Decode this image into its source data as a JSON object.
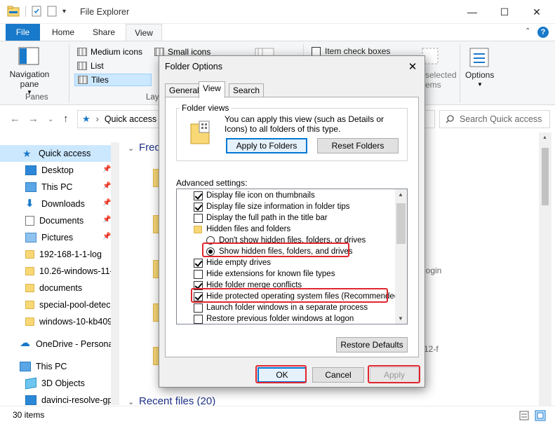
{
  "window": {
    "title": "File Explorer",
    "minimize": "—",
    "maximize": "☐",
    "close": "✕"
  },
  "ribbon_tabs": [
    "File",
    "Home",
    "Share",
    "View"
  ],
  "ribbon": {
    "navigation_pane": "Navigation\npane",
    "panes_label": "Panes",
    "layout_label": "Lay",
    "layout_items": [
      "Medium icons",
      "Small icons",
      "List",
      "Tiles"
    ],
    "item_check_boxes": "Item check boxes",
    "hide_selected": "selected\nems",
    "options": "Options"
  },
  "address": {
    "location": "Quick access",
    "search_placeholder": "Search Quick access"
  },
  "nav_items": [
    "Quick access",
    "Desktop",
    "This PC",
    "Downloads",
    "Documents",
    "Pictures",
    "192-168-1-1-log",
    "10.26-windows-11-",
    "documents",
    "special-pool-detec",
    "windows-10-kb409",
    "OneDrive - Personal",
    "This PC",
    "3D Objects",
    "davinci-resolve-gp"
  ],
  "content": {
    "frequent_header": "Freq",
    "recent_header": "Recent files (20)",
    "bg_texts": [
      "login",
      "12-f"
    ]
  },
  "status": {
    "count": "30 items"
  },
  "dialog": {
    "title": "Folder Options",
    "tabs": [
      "General",
      "View",
      "Search"
    ],
    "folder_views_title": "Folder views",
    "folder_views_text": "You can apply this view (such as Details or Icons) to all folders of this type.",
    "apply_to_folders": "Apply to Folders",
    "reset_folders": "Reset Folders",
    "advanced_label": "Advanced settings:",
    "advanced_items": [
      {
        "text": "Display file icon on thumbnails",
        "type": "checkbox",
        "checked": true
      },
      {
        "text": "Display file size information in folder tips",
        "type": "checkbox",
        "checked": true
      },
      {
        "text": "Display the full path in the title bar",
        "type": "checkbox",
        "checked": false
      },
      {
        "text": "Hidden files and folders",
        "type": "folder",
        "checked": false
      },
      {
        "text": "Don't show hidden files, folders, or drives",
        "type": "radio",
        "checked": false
      },
      {
        "text": "Show hidden files, folders, and drives",
        "type": "radio",
        "checked": true
      },
      {
        "text": "Hide empty drives",
        "type": "checkbox",
        "checked": true
      },
      {
        "text": "Hide extensions for known file types",
        "type": "checkbox",
        "checked": false
      },
      {
        "text": "Hide folder merge conflicts",
        "type": "checkbox",
        "checked": true
      },
      {
        "text": "Hide protected operating system files (Recommended)",
        "type": "checkbox",
        "checked": true
      },
      {
        "text": "Launch folder windows in a separate process",
        "type": "checkbox",
        "checked": false
      },
      {
        "text": "Restore previous folder windows at logon",
        "type": "checkbox",
        "checked": false
      }
    ],
    "restore_defaults": "Restore Defaults",
    "ok": "OK",
    "cancel": "Cancel",
    "apply": "Apply"
  },
  "colors": {
    "accent": "#1979ca",
    "highlight": "#e0262e",
    "selection": "#cce8ff"
  }
}
